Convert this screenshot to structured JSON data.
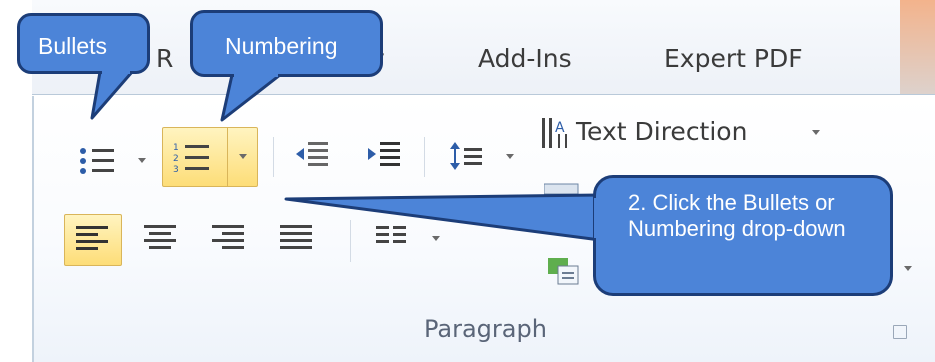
{
  "tabs": [
    {
      "label": "R"
    },
    {
      "label": "y"
    },
    {
      "label": "Add-Ins"
    },
    {
      "label": "Expert PDF"
    }
  ],
  "group": {
    "label": "Paragraph"
  },
  "text_direction": {
    "label": "Text Direction"
  },
  "callouts": {
    "bullets": "Bullets",
    "numbering": "Numbering",
    "instruction": "2. Click the Bullets or Numbering drop-down"
  },
  "colors": {
    "callout_fill": "#4c84d8",
    "callout_border": "#1c3d78",
    "highlight": "#fddd78"
  },
  "icons": [
    "bullets-icon",
    "numbering-icon",
    "decrease-indent-icon",
    "increase-indent-icon",
    "line-spacing-icon",
    "text-direction-icon",
    "align-left-icon",
    "center-icon",
    "align-right-icon",
    "justify-icon",
    "columns-icon",
    "smartart-icon",
    "dialog-launcher-icon"
  ]
}
